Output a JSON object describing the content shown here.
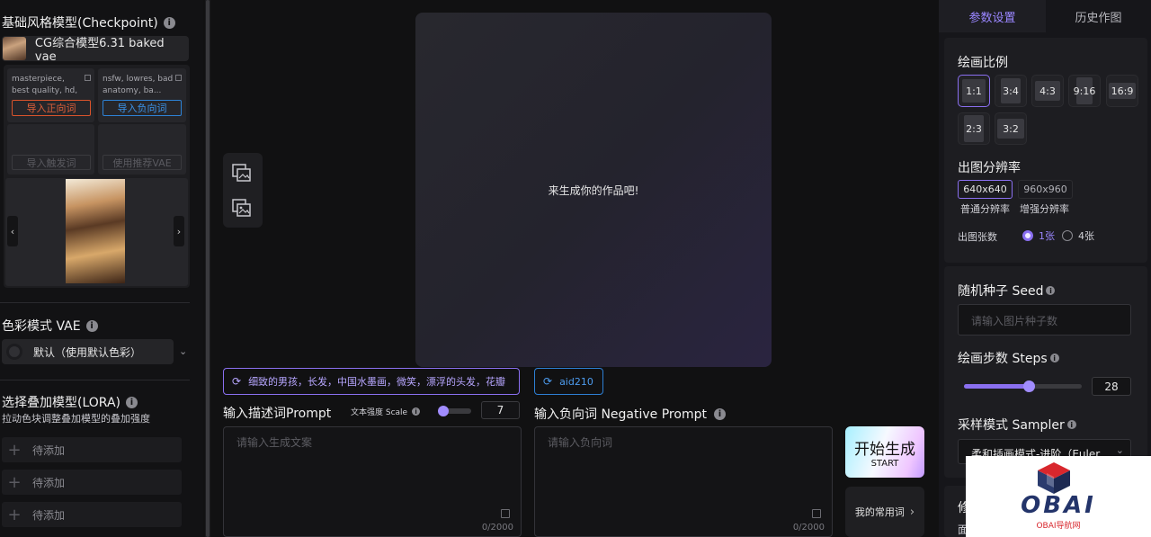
{
  "left": {
    "checkpoint": {
      "title": "基础风格模型(Checkpoint)",
      "model_name": "CG综合模型6.31 baked vae"
    },
    "prompts": {
      "positive_text": "masterpiece, best quality, hd, ...",
      "negative_text": "nsfw, lowres, bad anatomy, ba...",
      "import_positive": "导入正向词",
      "import_negative": "导入负向词",
      "import_trigger": "导入触发词",
      "use_vae": "使用推荐VAE"
    },
    "vae": {
      "title": "色彩模式 VAE",
      "value": "默认（使用默认色彩）"
    },
    "lora": {
      "title": "选择叠加模型(LORA)",
      "subtitle": "拉动色块调整叠加模型的叠加强度",
      "items": [
        "待添加",
        "待添加",
        "待添加"
      ]
    }
  },
  "center": {
    "canvas_placeholder": "来生成你的作品吧!",
    "positive_chip": "细致的男孩，长发，中国水墨画，微笑，漂浮的头发，花瓣",
    "negative_chip": "aid210",
    "prompt_label": "输入描述词Prompt",
    "scale_label": "文本强度 Scale",
    "scale_value": "7",
    "scale_fraction": 0.1,
    "prompt_placeholder": "请输入生成文案",
    "prompt_count": "0/2000",
    "neg_label": "输入负向词 Negative Prompt",
    "neg_placeholder": "请输入负向词",
    "neg_count": "0/2000",
    "start_big": "开始生成",
    "start_small": "START",
    "common_words": "我的常用词"
  },
  "right": {
    "tabs": [
      "参数设置",
      "历史作图"
    ],
    "ratio_title": "绘画比例",
    "ratios": [
      "1:1",
      "3:4",
      "4:3",
      "9:16",
      "16:9",
      "2:3",
      "3:2"
    ],
    "resolution_title": "出图分辨率",
    "resolutions": [
      {
        "value": "640x640",
        "label": "普通分辨率"
      },
      {
        "value": "960x960",
        "label": "增强分辨率"
      }
    ],
    "count_label": "出图张数",
    "count_options": [
      "1张",
      "4张"
    ],
    "seed_title": "随机种子 Seed",
    "seed_placeholder": "请输入图片种子数",
    "steps_title": "绘画步数 Steps",
    "steps_value": "28",
    "steps_fraction": 0.55,
    "sampler_title": "采样模式 Sampler",
    "sampler_value": "柔和插画模式-进阶（Euler",
    "more_char": "修",
    "more_char2": "面"
  },
  "watermark": {
    "title": "OBAI",
    "subtitle": "OBAI导航网"
  },
  "colors": {
    "accent": "#8a6ff0",
    "positive": "#e0603a",
    "negative": "#3c94eb"
  }
}
